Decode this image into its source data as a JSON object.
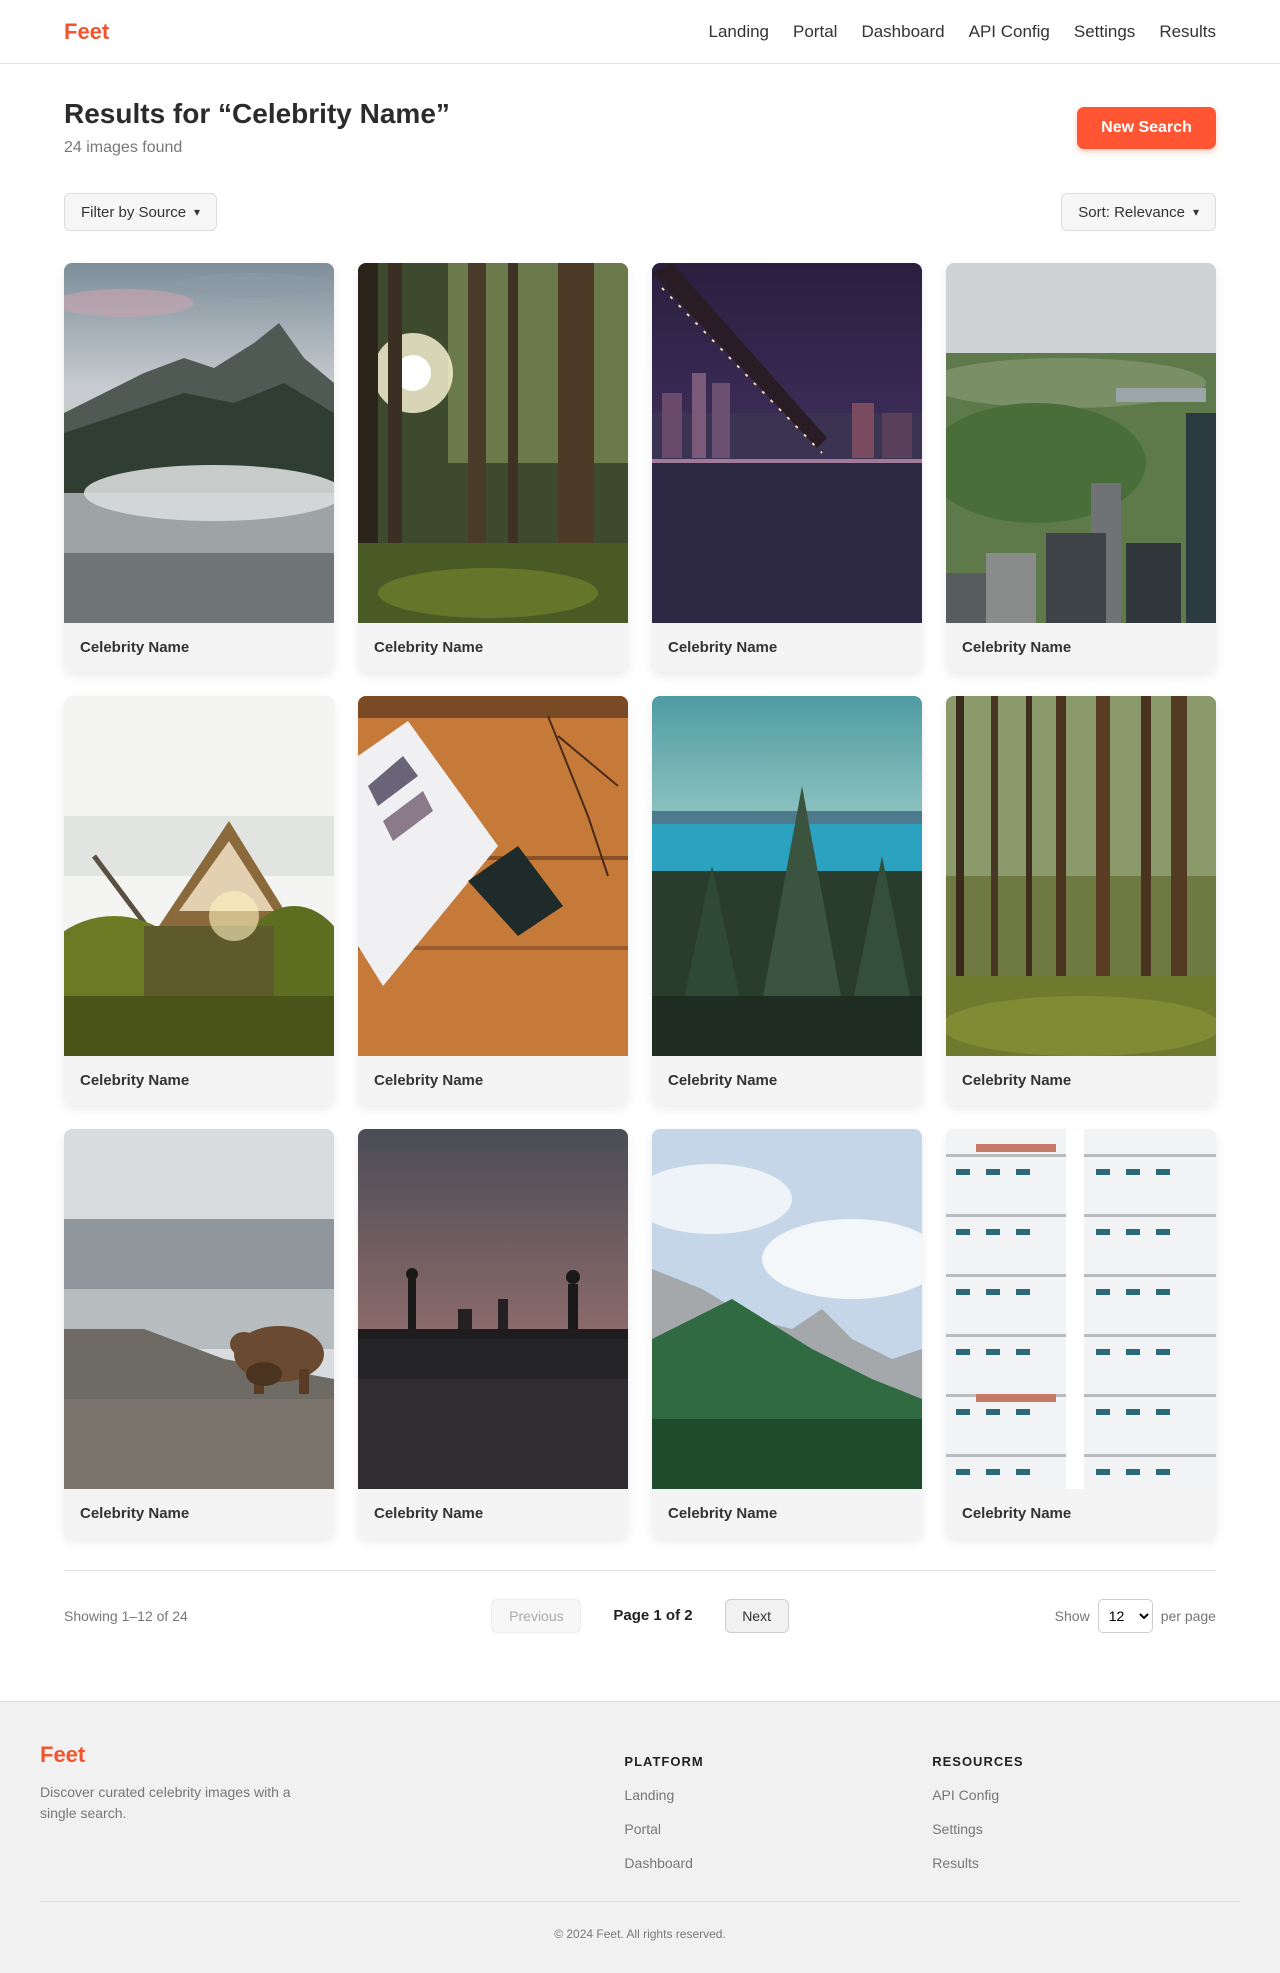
{
  "header": {
    "brand": "Feet",
    "nav": [
      "Landing",
      "Portal",
      "Dashboard",
      "API Config",
      "Settings",
      "Results"
    ]
  },
  "page": {
    "title": "Results for “Celebrity Name”",
    "subtitle": "24 images found",
    "new_search_label": "New Search"
  },
  "filters": {
    "source_label": "Filter by Source",
    "sort_label": "Sort: Relevance",
    "caret": "▾"
  },
  "results": [
    {
      "label": "Celebrity Name",
      "scene": "mountain"
    },
    {
      "label": "Celebrity Name",
      "scene": "forest-sun"
    },
    {
      "label": "Celebrity Name",
      "scene": "bridge-night"
    },
    {
      "label": "Celebrity Name",
      "scene": "city-park"
    },
    {
      "label": "Celebrity Name",
      "scene": "canoe"
    },
    {
      "label": "Celebrity Name",
      "scene": "desk-book"
    },
    {
      "label": "Celebrity Name",
      "scene": "lake-pines"
    },
    {
      "label": "Celebrity Name",
      "scene": "pine-grove"
    },
    {
      "label": "Celebrity Name",
      "scene": "bear"
    },
    {
      "label": "Celebrity Name",
      "scene": "bridge-statues"
    },
    {
      "label": "Celebrity Name",
      "scene": "mountain-forest"
    },
    {
      "label": "Celebrity Name",
      "scene": "building"
    }
  ],
  "pagination": {
    "showing": "Showing 1–12 of 24",
    "previous": "Previous",
    "page_info": "Page 1 of 2",
    "next": "Next",
    "show_label": "Show",
    "per_page_value": "12",
    "per_page_label": "per page"
  },
  "footer": {
    "brand": "Feet",
    "description": "Discover curated celebrity images with a single search.",
    "platform_heading": "PLATFORM",
    "platform_links": [
      "Landing",
      "Portal",
      "Dashboard"
    ],
    "resources_heading": "RESOURCES",
    "resources_links": [
      "API Config",
      "Settings",
      "Results"
    ],
    "copyright": "© 2024 Feet. All rights reserved."
  },
  "colors": {
    "accent": "#ff5533",
    "brand": "#f0552f"
  }
}
